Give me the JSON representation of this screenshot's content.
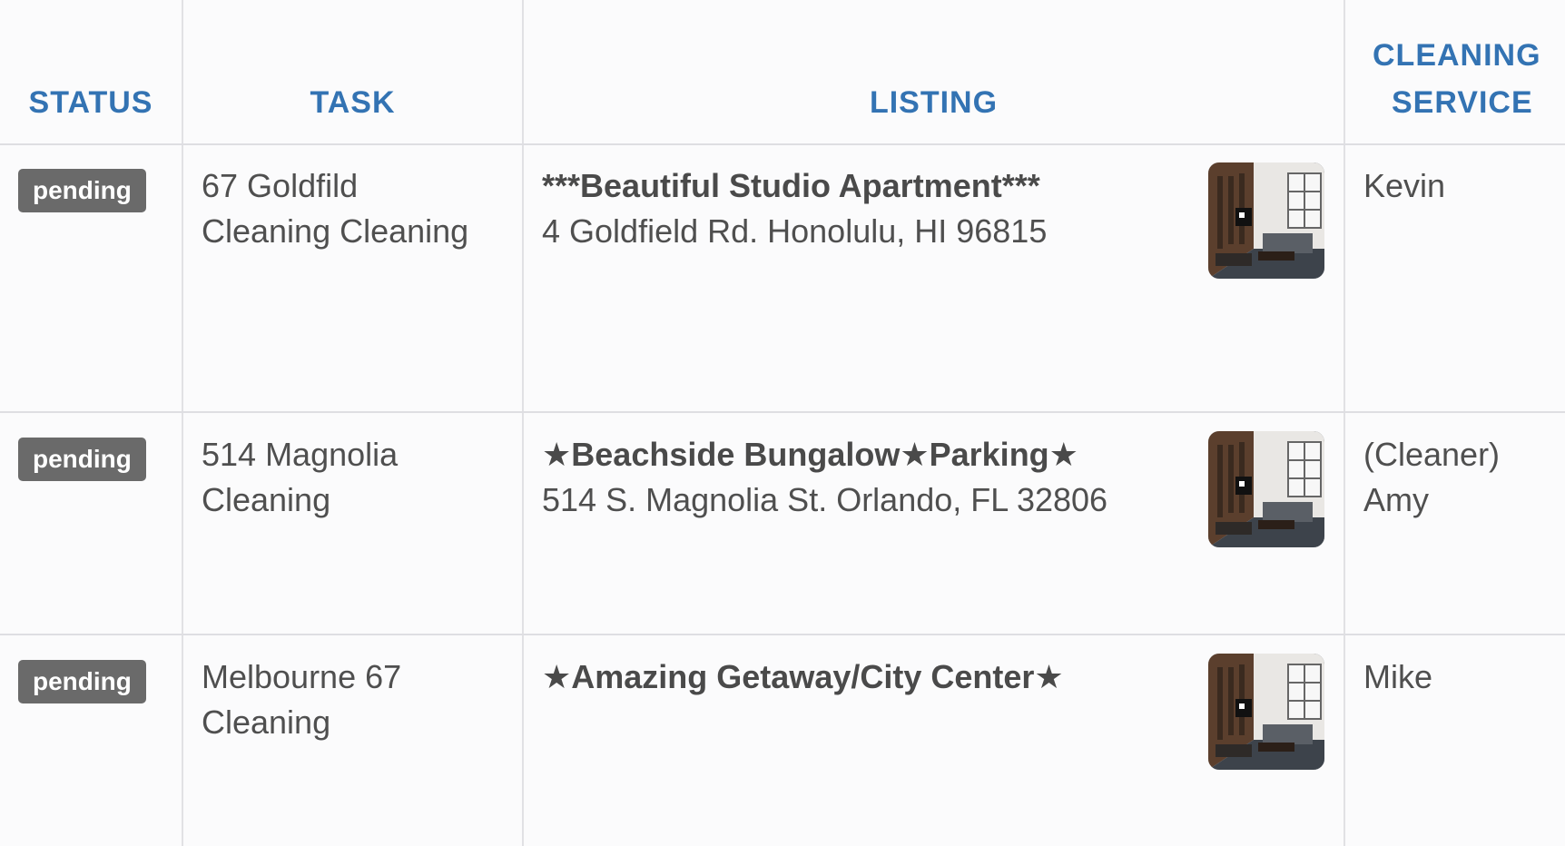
{
  "headers": {
    "status": "STATUS",
    "task": "TASK",
    "listing": "LISTING",
    "service_line1": "CLEANING",
    "service_line2": "SERVICE"
  },
  "rows": [
    {
      "status": "pending",
      "task_line1": "67 Goldfild",
      "task_line2": "Cleaning Cleaning",
      "listing_title": "***Beautiful Studio Apartment***",
      "listing_address": "4 Goldfield Rd. Honolulu, HI 96815",
      "service_line1": "Kevin",
      "service_line2": "",
      "thumbnail_icon": "living-room-photo"
    },
    {
      "status": "pending",
      "task_line1": "514 Magnolia",
      "task_line2": "Cleaning",
      "listing_title": "★Beachside Bungalow★Parking★",
      "listing_address": "514 S. Magnolia St. Orlando, FL 32806",
      "service_line1": "(Cleaner)",
      "service_line2": "Amy",
      "thumbnail_icon": "living-room-photo"
    },
    {
      "status": "pending",
      "task_line1": "Melbourne 67",
      "task_line2": "Cleaning",
      "listing_title": "★Amazing Getaway/City Center★",
      "listing_address": "",
      "service_line1": "Mike",
      "service_line2": "",
      "thumbnail_icon": "living-room-photo"
    }
  ],
  "colors": {
    "header_text": "#3373b3",
    "badge_bg": "#6a6a6a",
    "grid_line": "#e1e1e4"
  }
}
